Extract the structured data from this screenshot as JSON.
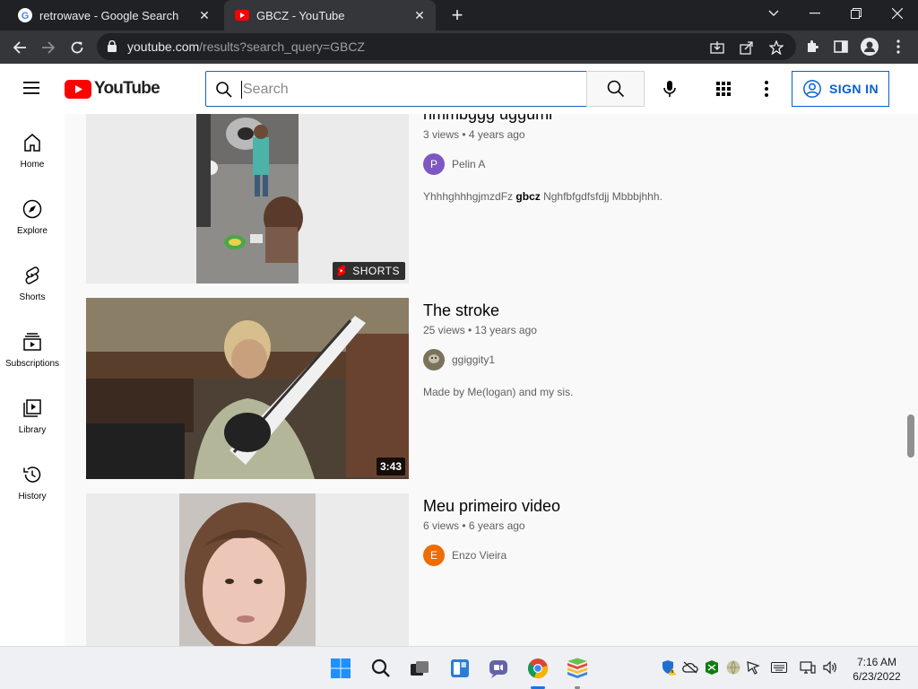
{
  "browser": {
    "tabs": [
      {
        "title": "retrowave - Google Search",
        "icon": "google-icon",
        "active": false
      },
      {
        "title": "GBCZ - YouTube",
        "icon": "youtube-icon",
        "active": true
      }
    ],
    "url_domain": "youtube.com",
    "url_path": "/results?search_query=GBCZ"
  },
  "youtube": {
    "logo_text": "YouTube",
    "search_placeholder": "Search",
    "signin_label": "SIGN IN",
    "guide": [
      {
        "label": "Home",
        "icon": "home-icon"
      },
      {
        "label": "Explore",
        "icon": "compass-icon"
      },
      {
        "label": "Shorts",
        "icon": "shorts-icon"
      },
      {
        "label": "Subscriptions",
        "icon": "subscriptions-icon"
      },
      {
        "label": "Library",
        "icon": "library-icon"
      },
      {
        "label": "History",
        "icon": "history-icon"
      }
    ],
    "results": [
      {
        "title": "hmmbggg uggumi",
        "meta": "3 views • 4 years ago",
        "channel": "Pelin A",
        "avatar_letter": "P",
        "avatar_color": "#7e57c2",
        "desc_pre": "YhhhghhhgjmzdFz ",
        "desc_bold": "gbcz",
        "desc_post": " Nghfbfgdfsfdjj Mbbbjhhh.",
        "badge": "SHORTS"
      },
      {
        "title": "The stroke",
        "meta": "25 views • 13 years ago",
        "channel": "ggiggity1",
        "desc": "Made by Me(logan) and my sis.",
        "badge": "3:43"
      },
      {
        "title": "Meu primeiro video",
        "meta": "6 views • 6 years ago",
        "channel": "Enzo Vieira",
        "avatar_letter": "E",
        "avatar_color": "#ef6c00"
      }
    ]
  },
  "taskbar": {
    "time": "7:16 AM",
    "date": "6/23/2022"
  }
}
